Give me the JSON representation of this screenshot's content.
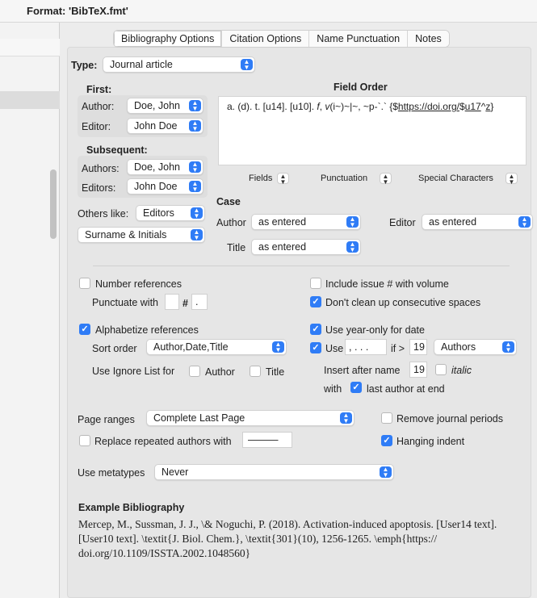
{
  "window": {
    "title": "Format: 'BibTeX.fmt'"
  },
  "tabs": [
    {
      "label": "Bibliography Options",
      "active": true
    },
    {
      "label": "Citation Options"
    },
    {
      "label": "Name Punctuation"
    },
    {
      "label": "Notes"
    }
  ],
  "type": {
    "label": "Type:",
    "value": "Journal article"
  },
  "first": {
    "heading": "First:",
    "author_label": "Author:",
    "author_value": "Doe, John",
    "editor_label": "Editor:",
    "editor_value": "John Doe"
  },
  "subsequent": {
    "heading": "Subsequent:",
    "authors_label": "Authors:",
    "authors_value": "Doe, John",
    "editors_label": "Editors:",
    "editors_value": "John Doe"
  },
  "others_like": {
    "label": "Others like:",
    "value": "Editors"
  },
  "name_format": {
    "value": "Surname & Initials"
  },
  "field_order": {
    "heading": "Field Order",
    "pre": "a. (d). t. [u14]. [u10]. ",
    "f": "f",
    "mid1": ", ",
    "v": "v",
    "mid2": "(i~)~|~, ~p-`.` {$",
    "url": "https://doi.org/",
    "mid3": "$",
    "u17": "u17",
    "caret": "^",
    "z": "z",
    "end": "}"
  },
  "field_menus": {
    "fields": "Fields",
    "punctuation": "Punctuation",
    "special": "Special Characters"
  },
  "case": {
    "heading": "Case",
    "author_label": "Author",
    "author_value": "as entered",
    "editor_label": "Editor",
    "editor_value": "as entered",
    "title_label": "Title",
    "title_value": "as entered"
  },
  "options": {
    "number_references": {
      "label": "Number references",
      "checked": false
    },
    "punctuate_with": {
      "label": "Punctuate with",
      "before": "",
      "hash": "#",
      "after": "."
    },
    "alphabetize": {
      "label": "Alphabetize references",
      "checked": true
    },
    "sort_order": {
      "label": "Sort order",
      "value": "Author,Date,Title"
    },
    "ignore_list": {
      "label": "Use Ignore List for",
      "author": "Author",
      "title": "Title"
    },
    "include_issue": {
      "label": "Include issue # with volume",
      "checked": false
    },
    "dont_clean": {
      "label": "Don't clean up consecutive spaces",
      "checked": true
    },
    "year_only": {
      "label": "Use year-only for date",
      "checked": true
    },
    "use_etal": {
      "label": "Use",
      "value": ", . . .",
      "if_label": "if >",
      "if_value": "19",
      "who": "Authors",
      "checked": true
    },
    "insert_after": {
      "label": "Insert after name",
      "value": "19",
      "italic": "italic"
    },
    "with": {
      "label": "with",
      "last_author": "last author at end",
      "checked": true
    },
    "page_ranges": {
      "label": "Page ranges",
      "value": "Complete Last Page"
    },
    "remove_periods": {
      "label": "Remove journal periods",
      "checked": false
    },
    "replace_authors": {
      "label": "Replace repeated authors with",
      "value": "———"
    },
    "hanging_indent": {
      "label": "Hanging indent",
      "checked": true
    },
    "metatypes": {
      "label": "Use metatypes",
      "value": "Never"
    }
  },
  "example": {
    "heading": "Example Bibliography",
    "text": "Mercep, M., Sussman, J. J., \\& Noguchi, P. (2018). Activation-induced apoptosis. [User14 text]. [User10 text]. \\textit{J. Biol. Chem.}, \\textit{301}(10), 1256-1265. \\emph{https:// doi.org/10.1109/ISSTA.2002.1048560}"
  },
  "colors": {
    "accent": "#2f7cf6",
    "panel": "#e6e6e6"
  }
}
